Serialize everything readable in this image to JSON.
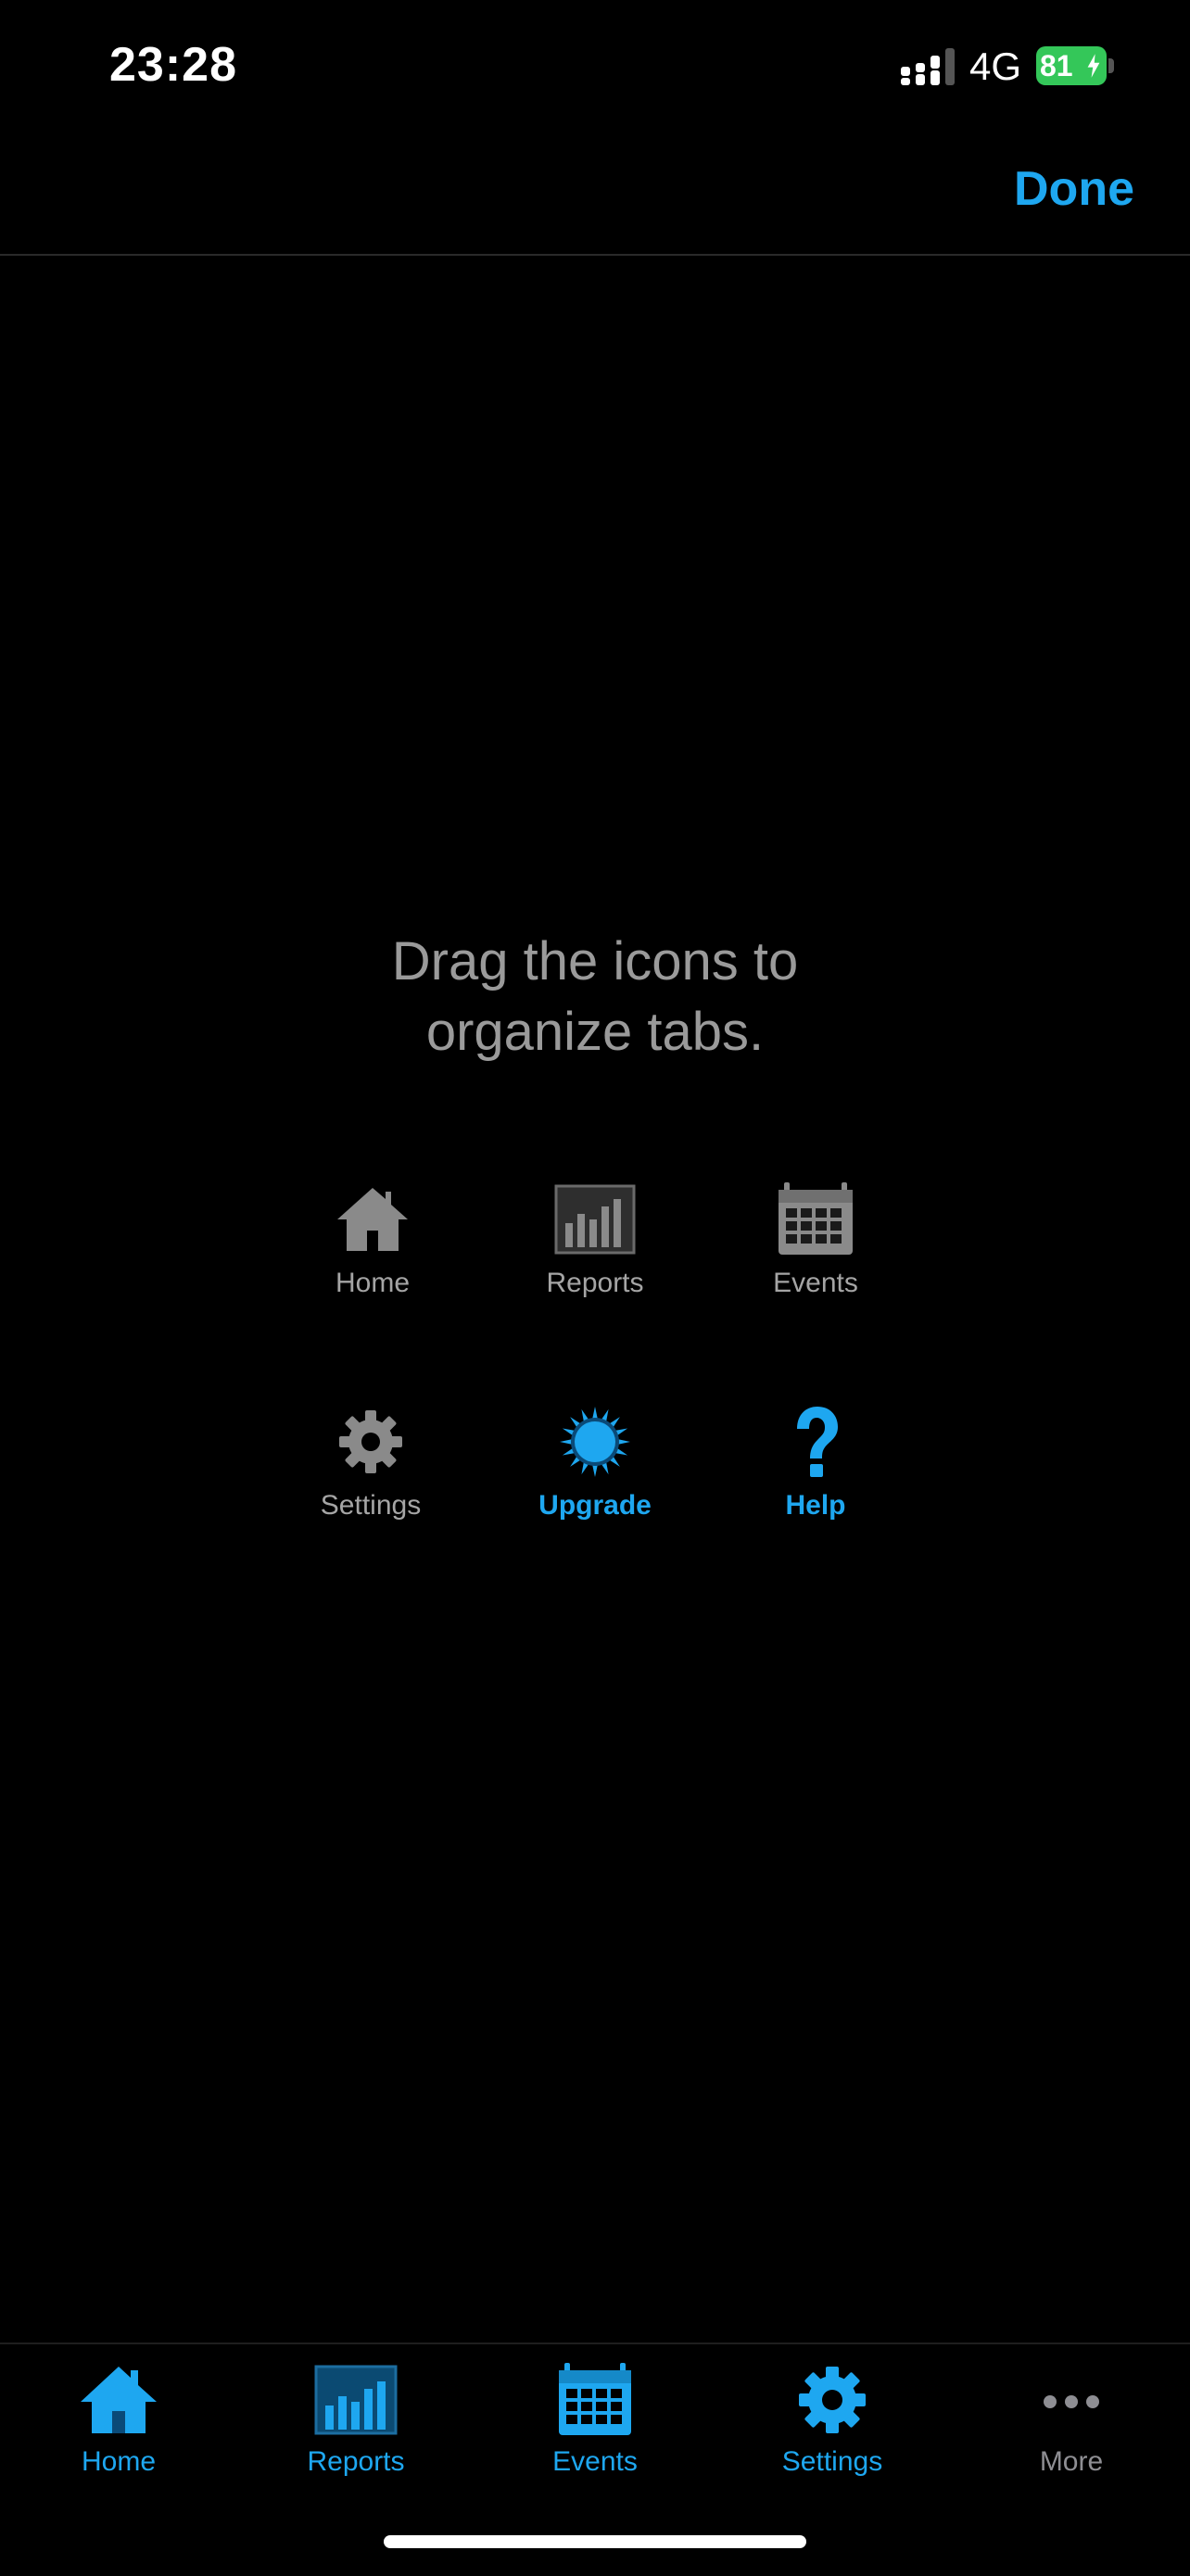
{
  "status_bar": {
    "time": "23:28",
    "network": "4G",
    "battery": "81"
  },
  "nav": {
    "done_label": "Done"
  },
  "instruction": {
    "line1": "Drag the icons to",
    "line2": "organize tabs."
  },
  "grid": {
    "items": [
      {
        "label": "Home",
        "icon": "house-icon"
      },
      {
        "label": "Reports",
        "icon": "bar-chart-icon"
      },
      {
        "label": "Events",
        "icon": "calendar-icon"
      },
      {
        "label": "Settings",
        "icon": "gear-icon"
      },
      {
        "label": "Upgrade",
        "icon": "sun-icon"
      },
      {
        "label": "Help",
        "icon": "question-icon"
      }
    ]
  },
  "tabs": {
    "items": [
      {
        "label": "Home",
        "icon": "house-icon"
      },
      {
        "label": "Reports",
        "icon": "bar-chart-icon"
      },
      {
        "label": "Events",
        "icon": "calendar-icon"
      },
      {
        "label": "Settings",
        "icon": "gear-icon"
      },
      {
        "label": "More",
        "icon": "ellipsis-icon"
      }
    ]
  },
  "colors": {
    "accent": "#1ea7f0",
    "muted": "#8e8e93",
    "grid_icon": "#8a8a8a",
    "battery": "#34c759"
  }
}
